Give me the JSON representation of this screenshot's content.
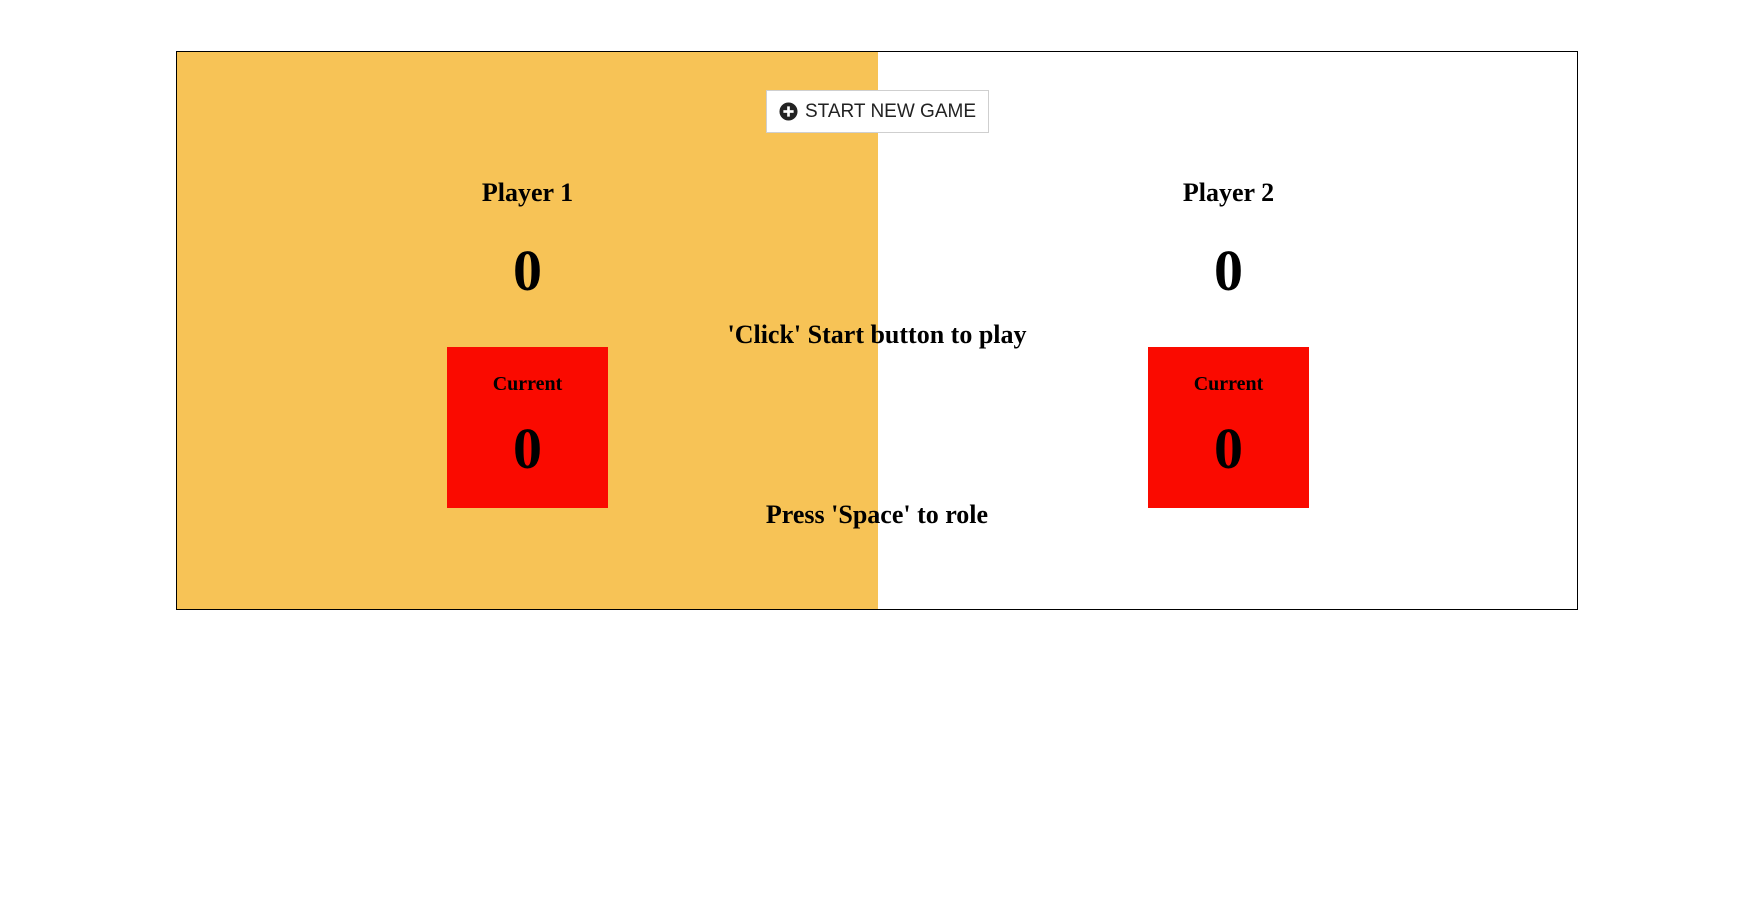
{
  "start_button": {
    "label": "START NEW GAME",
    "icon": "plus-circle-icon"
  },
  "players": [
    {
      "name": "Player 1",
      "score": "0",
      "current_label": "Current",
      "current_score": "0",
      "active": true
    },
    {
      "name": "Player 2",
      "score": "0",
      "current_label": "Current",
      "current_score": "0",
      "active": false
    }
  ],
  "messages": {
    "click_start": "'Click' Start button to play",
    "press_space": "Press 'Space' to role"
  },
  "colors": {
    "active_panel": "#f7c356",
    "current_box": "#fa0a00",
    "inactive_panel": "#ffffff"
  }
}
